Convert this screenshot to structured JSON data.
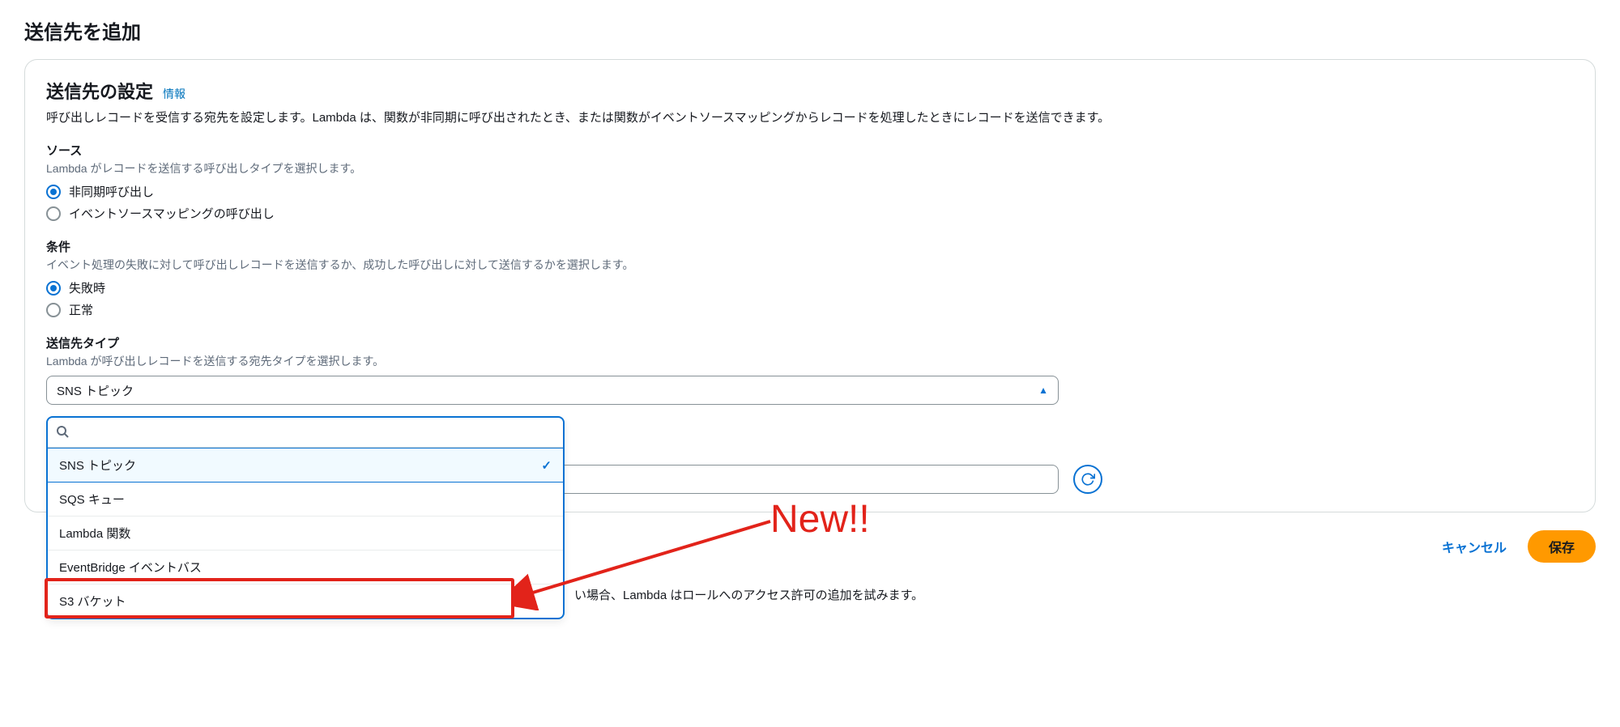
{
  "page": {
    "title": "送信先を追加"
  },
  "panel": {
    "title": "送信先の設定",
    "info_link": "情報",
    "description": "呼び出しレコードを受信する宛先を設定します。Lambda は、関数が非同期に呼び出されたとき、または関数がイベントソースマッピングからレコードを処理したときにレコードを送信できます。"
  },
  "source": {
    "label": "ソース",
    "hint": "Lambda がレコードを送信する呼び出しタイプを選択します。",
    "options": [
      "非同期呼び出し",
      "イベントソースマッピングの呼び出し"
    ],
    "selected_index": 0
  },
  "condition": {
    "label": "条件",
    "hint": "イベント処理の失敗に対して呼び出しレコードを送信するか、成功した呼び出しに対して送信するかを選択します。",
    "options": [
      "失敗時",
      "正常"
    ],
    "selected_index": 0
  },
  "dest_type": {
    "label": "送信先タイプ",
    "hint": "Lambda が呼び出しレコードを送信する宛先タイプを選択します。",
    "selected": "SNS トピック",
    "search_placeholder": "",
    "options": [
      "SNS トピック",
      "SQS キュー",
      "Lambda 関数",
      "EventBridge イベントバス",
      "S3 バケット"
    ],
    "selected_option_index": 0
  },
  "permission_note_fragment": "い場合、Lambda はロールへのアクセス許可の追加を試みます。",
  "footer": {
    "cancel": "キャンセル",
    "save": "保存"
  },
  "annotation": {
    "text": "New!!"
  }
}
